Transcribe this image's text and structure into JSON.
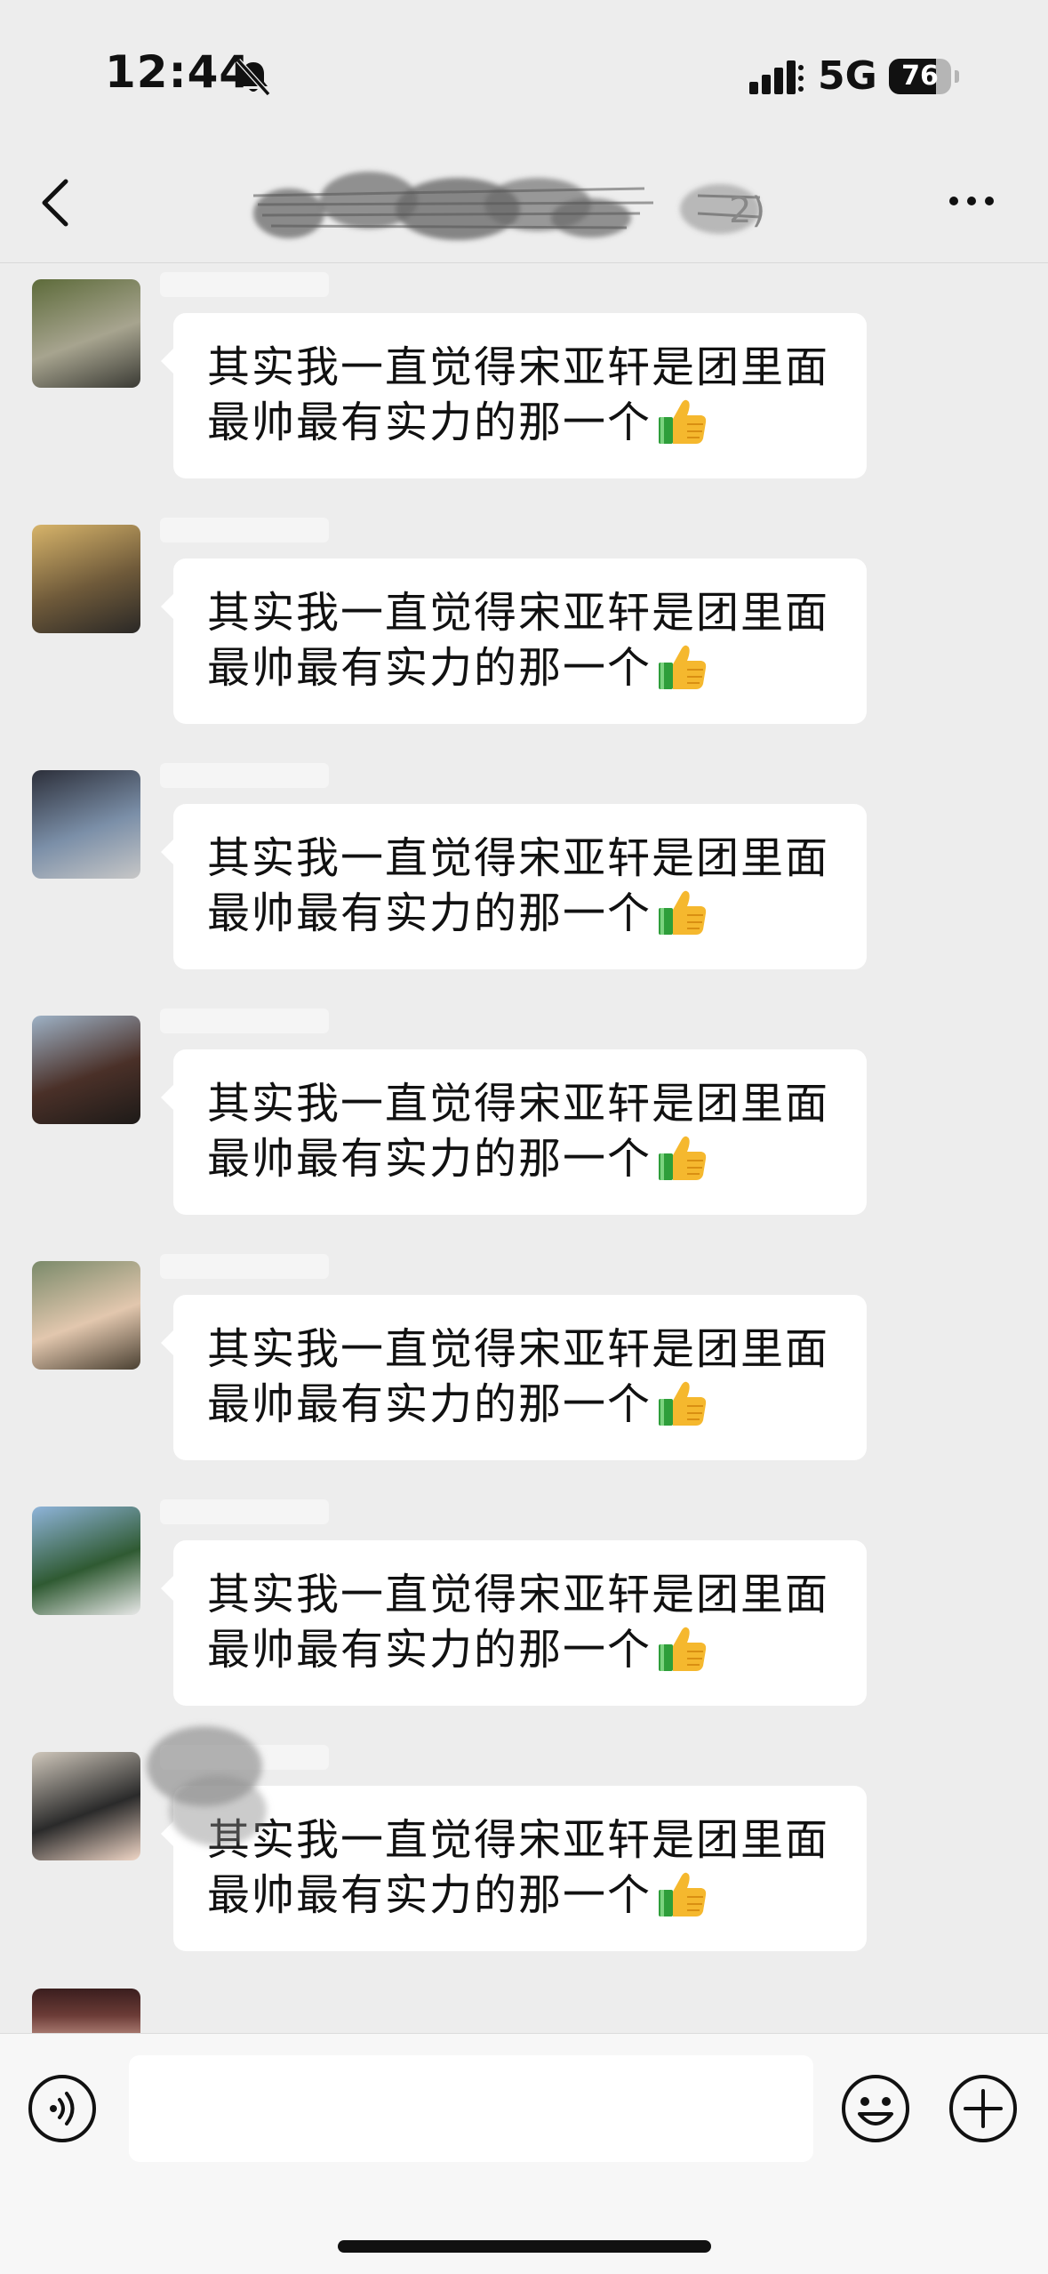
{
  "status_bar": {
    "time": "12:44",
    "network": "5G",
    "battery_level": "76",
    "battery_fraction": 0.76,
    "icons": [
      "mute-bell-icon",
      "signal-bars-icon"
    ]
  },
  "nav": {
    "back_icon": "chevron-left-icon",
    "title": "",
    "more_icon": "ellipsis-icon"
  },
  "messages": [
    {
      "avatar_colors": [
        "#5d6b3a",
        "#a7a48f",
        "#3a3a34"
      ],
      "text": "其实我一直觉得宋亚轩是团里面最帅最有实力的那一个",
      "emoji": "thumbs-up-icon"
    },
    {
      "avatar_colors": [
        "#d7b46a",
        "#6f5a3a",
        "#2a2826"
      ],
      "text": "其实我一直觉得宋亚轩是团里面最帅最有实力的那一个",
      "emoji": "thumbs-up-icon"
    },
    {
      "avatar_colors": [
        "#2c2f3a",
        "#7b8fa8",
        "#c7c7c7"
      ],
      "text": "其实我一直觉得宋亚轩是团里面最帅最有实力的那一个",
      "emoji": "thumbs-up-icon"
    },
    {
      "avatar_colors": [
        "#9eb2c6",
        "#4a3028",
        "#1d1a18"
      ],
      "text": "其实我一直觉得宋亚轩是团里面最帅最有实力的那一个",
      "emoji": "thumbs-up-icon"
    },
    {
      "avatar_colors": [
        "#7a8a6a",
        "#e2c7ae",
        "#4a4032"
      ],
      "text": "其实我一直觉得宋亚轩是团里面最帅最有实力的那一个",
      "emoji": "thumbs-up-icon"
    },
    {
      "avatar_colors": [
        "#8fb4da",
        "#2f5a32",
        "#e8e8e8"
      ],
      "text": "其实我一直觉得宋亚轩是团里面最帅最有实力的那一个",
      "emoji": "thumbs-up-icon"
    },
    {
      "avatar_colors": [
        "#cfc7bb",
        "#2a2a2a",
        "#f1d7c7"
      ],
      "text": "其实我一直觉得宋亚轩是团里面最帅最有实力的那一个",
      "emoji": "thumbs-up-icon"
    }
  ],
  "input_bar": {
    "voice_icon": "voice-icon",
    "input_value": "",
    "emoji_icon": "smiley-icon",
    "add_icon": "plus-circle-icon"
  },
  "colors": {
    "background": "#ededed",
    "bubble": "#ffffff",
    "input_bar": "#f7f7f7",
    "thumb_yellow": "#f5b82e",
    "sleeve_green": "#2e9e3a"
  }
}
